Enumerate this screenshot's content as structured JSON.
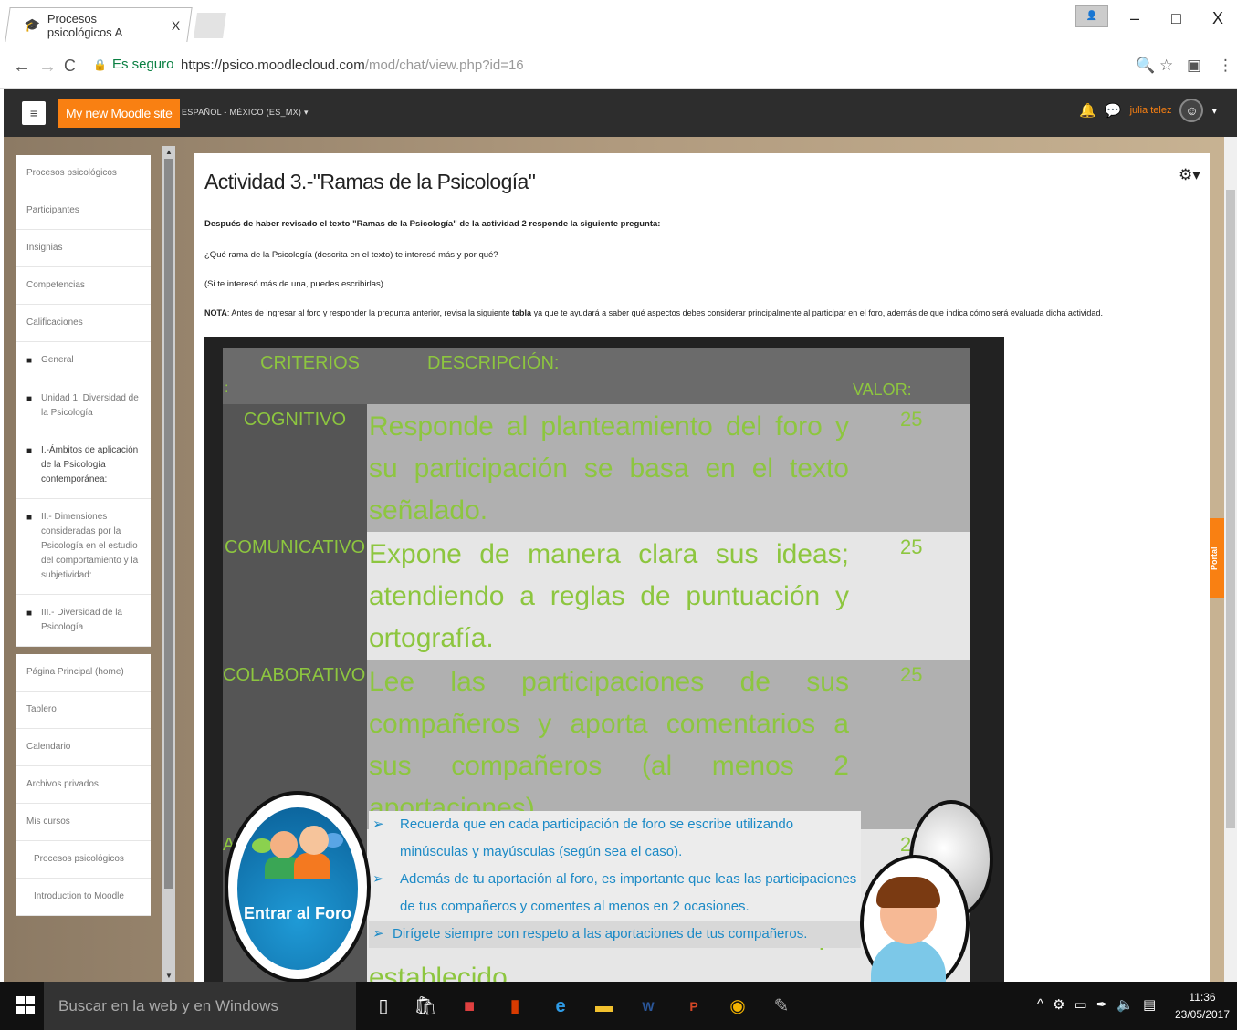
{
  "browser": {
    "tab_title": "Procesos psicológicos A",
    "tab_close": "X",
    "secure_label": "Es seguro",
    "url_host": "https://psico.moodlecloud.com",
    "url_path": "/mod/chat/view.php?id=16",
    "back_icon": "←",
    "forward_icon": "→",
    "reload_icon": "C",
    "zoom_icon": "🔍",
    "star_icon": "☆",
    "menu_icon": "⋮",
    "win_minimize": "–",
    "win_restore": "□",
    "win_close": "X"
  },
  "moodle": {
    "site_name": "My new Moodle site",
    "language": "ESPAÑOL - MÉXICO (ES_MX) ▾",
    "user_name": "julia telez"
  },
  "sidebar": {
    "nav": [
      {
        "label": "Procesos psicológicos"
      },
      {
        "label": "Participantes"
      },
      {
        "label": "Insignias"
      },
      {
        "label": "Competencias"
      },
      {
        "label": "Calificaciones"
      },
      {
        "label": "General",
        "folder": true
      },
      {
        "label": "Unidad 1. Diversidad de la Psicología",
        "folder": true
      },
      {
        "label": "I.-Ámbitos de aplicación de la Psicología contemporánea:",
        "folder": true
      },
      {
        "label": "II.- Dimensiones consideradas por la Psicología en el estudio del comportamiento y la subjetividad:",
        "folder": true
      },
      {
        "label": "III.- Diversidad de la Psicología",
        "folder": true
      }
    ],
    "site": [
      {
        "label": "Página Principal (home)"
      },
      {
        "label": "Tablero"
      },
      {
        "label": "Calendario"
      },
      {
        "label": "Archivos privados"
      },
      {
        "label": "Mis cursos"
      },
      {
        "label": "Procesos psicológicos"
      },
      {
        "label": "Introduction to Moodle"
      }
    ]
  },
  "main": {
    "title": "Actividad 3.-\"Ramas de la Psicología\"",
    "intro": "Después de haber revisado el texto \"Ramas de la Psicología\" de la actividad 2 responde la siguiente pregunta:",
    "question": "¿Qué rama de la Psicología (descrita en el texto) te interesó más y por qué?",
    "hint": "(Si te interesó más de una, puedes escribirlas)",
    "note_label": "NOTA",
    "note_a": "Antes de ingresar al foro y responder la pregunta anterior, revisa la siguiente ",
    "note_bold": "tabla",
    "note_b": " ya que te ayudará a saber qué aspectos debes considerar principalmente al participar en el foro, además de que indica cómo será evaluada dicha actividad."
  },
  "rubric": {
    "headers": {
      "criterio": "CRITERIOS",
      "criterio_colon": ":",
      "descripcion": "DESCRIPCIÓN:",
      "valor": "VALOR:"
    },
    "rows": [
      {
        "criterio": "COGNITIVO",
        "descripcion": "Responde al planteamiento del foro y su participación se basa en el texto señalado.",
        "valor": "25"
      },
      {
        "criterio": "COMUNICATIVO",
        "descripcion": "Expone de manera clara sus ideas; atendiendo a reglas de puntuación y ortografía.",
        "valor": "25"
      },
      {
        "criterio": "COLABORATIVO",
        "descripcion": "Lee las participaciones de sus compañeros y aporta comentarios a sus compañeros (al menos 2 aportaciones)",
        "valor": "25"
      },
      {
        "criterio": "ACTITUDINAL",
        "descripcion": "Se maneja con respeto hacia las participaciones de sus compañeros y realiza las actividades en el tiempo establecido.",
        "valor": "25"
      }
    ],
    "notes": [
      "Recuerda que en cada participación de foro se escribe utilizando minúsculas y mayúsculas (según sea el caso).",
      "Además de tu aportación al foro, es importante que leas las participaciones de tus compañeros y comentes al menos en 2 ocasiones.",
      "Dirígete siempre con respeto a las aportaciones de tus compañeros."
    ],
    "forum_button": "Entrar al Foro"
  },
  "portal_tab": "Portal",
  "taskbar": {
    "search_placeholder": "Buscar en la web y en Windows",
    "time": "11:36",
    "date": "23/05/2017"
  },
  "colors": {
    "moodle_orange": "#f98012",
    "rubric_green": "#8dc63f",
    "note_blue": "#1c8ac6"
  }
}
